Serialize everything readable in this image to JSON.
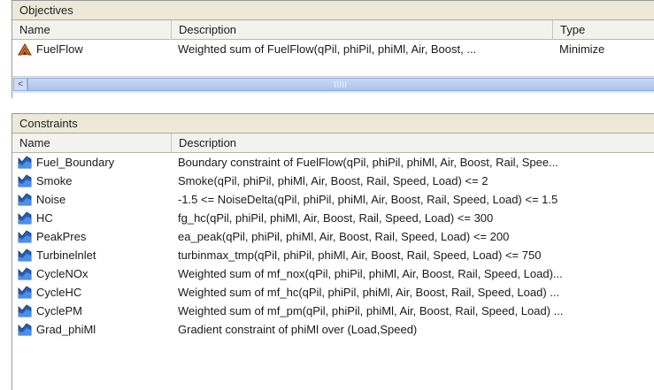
{
  "objectives": {
    "title": "Objectives",
    "columns": {
      "name": "Name",
      "description": "Description",
      "type": "Type"
    },
    "rows": [
      {
        "name": "FuelFlow",
        "description": "Weighted sum of FuelFlow(qPil, phiPil, phiMl, Air, Boost, ...",
        "type": "Minimize",
        "icon": "objective-icon"
      }
    ],
    "scroll_left_arrow": "<"
  },
  "constraints": {
    "title": "Constraints",
    "columns": {
      "name": "Name",
      "description": "Description"
    },
    "rows": [
      {
        "name": "Fuel_Boundary",
        "description": "Boundary constraint of FuelFlow(qPil, phiPil, phiMl, Air, Boost, Rail, Spee..."
      },
      {
        "name": "Smoke",
        "description": "Smoke(qPil, phiPil, phiMl, Air, Boost, Rail, Speed, Load) <= 2"
      },
      {
        "name": "Noise",
        "description": "-1.5 <= NoiseDelta(qPil, phiPil, phiMl, Air, Boost, Rail, Speed, Load) <= 1.5"
      },
      {
        "name": "HC",
        "description": "fg_hc(qPil, phiPil, phiMl, Air, Boost, Rail, Speed, Load) <= 300"
      },
      {
        "name": "PeakPres",
        "description": "ea_peak(qPil, phiPil, phiMl, Air, Boost, Rail, Speed, Load) <= 200"
      },
      {
        "name": "Turbinelnlet",
        "description": "turbinmax_tmp(qPil, phiPil, phiMl, Air, Boost, Rail, Speed, Load) <= 750"
      },
      {
        "name": "CycleNOx",
        "description": "Weighted sum of mf_nox(qPil, phiPil, phiMl, Air, Boost, Rail, Speed, Load)..."
      },
      {
        "name": "CycleHC",
        "description": "Weighted sum of mf_hc(qPil, phiPil, phiMl, Air, Boost, Rail, Speed, Load) ..."
      },
      {
        "name": "CyclePM",
        "description": "Weighted sum of mf_pm(qPil, phiPil, phiMl, Air, Boost, Rail, Speed, Load) ..."
      },
      {
        "name": "Grad_phiMl",
        "description": "Gradient constraint of phiMl over (Load,Speed)"
      }
    ]
  },
  "colors": {
    "section_bg": "#ece9d8",
    "header_bg": "#f3f3ee",
    "constraint_icon": "#1f5fbf",
    "objective_icon_orange": "#e07a10",
    "objective_icon_dark": "#7a2a10",
    "scrollbar": "#aac3ec"
  }
}
